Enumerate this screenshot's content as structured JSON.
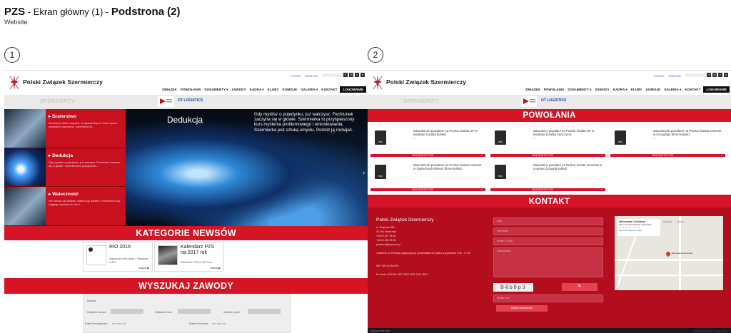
{
  "header": {
    "brand": "PZS",
    "sep1": " - Ekran główny (1) - ",
    "sub_page": "Podstrona (2)",
    "subtitle": "Website"
  },
  "markers": [
    "1",
    "2"
  ],
  "site": {
    "name": "Polski Związek Szermierczy",
    "langs": [
      "POLSKI",
      "ENGLISH"
    ],
    "social": [
      "f",
      "G",
      "t",
      "v"
    ],
    "nav": [
      "ZWIĄZEK",
      "POWOŁANIA",
      "DOKUMENTY ▾",
      "ZAWODY",
      "KADRA ▾",
      "KLUBY",
      "KOMISJE",
      "GALERIA ▾",
      "KONTAKT"
    ],
    "login": "LOGOWANIE",
    "sponsors_label": "SPONSORZY:",
    "sponsor_ot": "OT LOGISTICS"
  },
  "screen1": {
    "hero_items": [
      {
        "title": "▸ Braterstwo",
        "desc": "Inwestuj w dobro wspólne, a zaprocentuje to lorem ipsum osobistych sukcesów. Szermierka to..."
      },
      {
        "title": "▸ Dedukcja",
        "desc": "Gdy myślisz o pojedynku, już walczysz. Fechtunek zaczyna się w głowie. Szermierka to przyśpieszo..."
      },
      {
        "title": "▸ Waleczność",
        "desc": "Nie rodzisz się wielkim, stajesz się wielkim. Fechtunek uczy ciągłego dążenia do celu i..."
      }
    ],
    "hero_title": "Dedukcja",
    "hero_quote": "Gdy myślisz o pojedynku, już walczysz. Fechtunek zaczyna się w głowie. Szermierka to przyśpieszony kurs myślenia problemowego i wnioskowania. Szermierka jest sztuką umysłu. Pomóż ją rozwijać.",
    "categories_title": "KATEGORIE NEWSÓW",
    "news": [
      {
        "title": "RIO 2016",
        "desc": "Najnowsze informacje z Olimpiady w RIO",
        "more": "Więcej ▶"
      },
      {
        "title": "Kalendarz PZS na 2017 rok",
        "desc": "Kalendarz PZS na 2017 rok",
        "more": "Więcej ▶"
      }
    ],
    "search_title": "WYSZUKAJ ZAWODY",
    "search": {
      "name_label": "Nazwa",
      "season_label": "Wybierz sezon",
      "weapon_label": "Wybierz broń",
      "gender_label": "Wybierz płeć",
      "start_label": "Data Początkowa",
      "end_label": "Data Końcowa",
      "date_placeholder": "rrrr-mm-dd"
    }
  },
  "screen2": {
    "powolania_title": "POWOŁANIA",
    "docs": [
      {
        "title": "Zawodniczki powołane na Puchar Świata GP w Moskwie (szabla kobiet)",
        "date": "2016-08-29 09:17:06"
      },
      {
        "title": "Zawodnicy powołani na Puchar Świata GP w Moskwie (szabla mężczyzn)",
        "date": "2016-08-29 09:17:35"
      },
      {
        "title": "Zawodniczki powołane na Puchar Świata seniorek w Szanghaju (floret kobiet)",
        "date": "2016-08-29 09:17:35"
      },
      {
        "title": "Zawodniczki powołane na Puchar Świata seniorek w Tauberbischofsheim (floret kobiet)",
        "date": "2016-08-29 09:17:35"
      },
      {
        "title": "Zawodnicy powołani na Puchar Świata seniorów w Legnano (szpada kobiet)",
        "date": "2016-08-29 09:17:35"
      }
    ],
    "pdf": "PDF",
    "ellipsis": "...",
    "kontakt_title": "KONTAKT",
    "contact": {
      "name": "Polski Związek Szermierczy",
      "addr1": "ul. Grójecka 65A",
      "addr2": "02-094 Warszawa",
      "tel1": "+48 22 827 28 25",
      "tel2": "+48 22 828 38 06",
      "email": "pzszerm@pzszerm.pl",
      "hours": "Jesteśmy do Państwa dyspozycji od poniedziałku do piątku w godzinach 9:00 - 17:00",
      "nip": "NIP: 525-14-86-009",
      "account": "Nr Konta: 63 1640 1387 0000 0000 1311 9813"
    },
    "form": [
      "Imię",
      "Nazwisko",
      "Adres E-mail",
      "Wiadomość"
    ],
    "captcha": "B4b8p3",
    "refresh": "↻",
    "captcha_field": "Wpisz kod",
    "submit": "Wyślij wiadomość",
    "map": {
      "place": "Warszawa Centralna",
      "addr": "Aleje Jerozolimskie 54, Warszawa",
      "rating": "4,0 ★★★★☆ 3 opinie",
      "more": "Wyświetl większą mapę",
      "dir": "Wyznacz",
      "save": "Zapisz"
    },
    "footer_left": "Copyright PZS 2016",
    "footer_right": "Polityka prywatności · Mapa strony"
  }
}
